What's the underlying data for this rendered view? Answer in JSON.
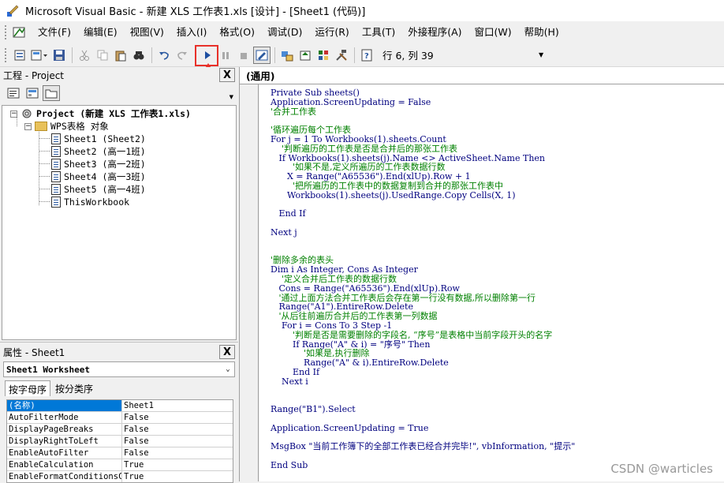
{
  "window": {
    "title": "Microsoft Visual Basic - 新建 XLS 工作表1.xls [设计] - [Sheet1 (代码)]"
  },
  "menu": {
    "items": [
      "文件(F)",
      "编辑(E)",
      "视图(V)",
      "插入(I)",
      "格式(O)",
      "调试(D)",
      "运行(R)",
      "工具(T)",
      "外接程序(A)",
      "窗口(W)",
      "帮助(H)"
    ]
  },
  "toolbar": {
    "status": "行 6, 列 39"
  },
  "project_panel": {
    "title": "工程 - Project",
    "close": "X",
    "tree": {
      "root": "Project (新建 XLS 工作表1.xls)",
      "folder": "WPS表格 对象",
      "items": [
        "Sheet1 (Sheet2)",
        "Sheet2 (高一1班)",
        "Sheet3 (高一2班)",
        "Sheet4 (高一3班)",
        "Sheet5 (高一4班)",
        "ThisWorkbook"
      ]
    }
  },
  "properties_panel": {
    "title": "属性 - Sheet1",
    "close": "X",
    "object": "Sheet1 Worksheet",
    "tabs": [
      "按字母序",
      "按分类序"
    ],
    "rows": [
      {
        "name": "(名称)",
        "value": "Sheet1"
      },
      {
        "name": "AutoFilterMode",
        "value": "False"
      },
      {
        "name": "DisplayPageBreaks",
        "value": "False"
      },
      {
        "name": "DisplayRightToLeft",
        "value": "False"
      },
      {
        "name": "EnableAutoFilter",
        "value": "False"
      },
      {
        "name": "EnableCalculation",
        "value": "True"
      },
      {
        "name": "EnableFormatConditionsCa",
        "value": "True"
      }
    ]
  },
  "code_window": {
    "scope": "(通用)",
    "lines": [
      {
        "text": "Private Sub sheets()",
        "kind": "code"
      },
      {
        "text": "Application.ScreenUpdating = False",
        "kind": "code"
      },
      {
        "text": "'合并工作表",
        "kind": "comment"
      },
      {
        "text": "",
        "kind": "code"
      },
      {
        "text": "'循环遍历每个工作表",
        "kind": "comment"
      },
      {
        "text": "For j = 1 To Workbooks(1).sheets.Count",
        "kind": "code"
      },
      {
        "text": "    '判断遍历的工作表是否是合并后的那张工作表",
        "kind": "comment"
      },
      {
        "text": "   If Workbooks(1).sheets(j).Name <> ActiveSheet.Name Then",
        "kind": "code"
      },
      {
        "text": "        '如果不是,定义所遍历的工作表数据行数",
        "kind": "comment"
      },
      {
        "text": "      X = Range(\"A65536\").End(xlUp).Row + 1",
        "kind": "code"
      },
      {
        "text": "        '把所遍历的工作表中的数据复制到合并的那张工作表中",
        "kind": "comment"
      },
      {
        "text": "      Workbooks(1).sheets(j).UsedRange.Copy Cells(X, 1)",
        "kind": "code"
      },
      {
        "text": "",
        "kind": "code"
      },
      {
        "text": "   End If",
        "kind": "code"
      },
      {
        "text": "",
        "kind": "code"
      },
      {
        "text": "Next j",
        "kind": "code"
      },
      {
        "text": "",
        "kind": "code"
      },
      {
        "text": "",
        "kind": "code"
      },
      {
        "text": "'删除多余的表头",
        "kind": "comment"
      },
      {
        "text": "Dim i As Integer, Cons As Integer",
        "kind": "code"
      },
      {
        "text": "    '定义合并后工作表的数据行数",
        "kind": "comment"
      },
      {
        "text": "   Cons = Range(\"A65536\").End(xlUp).Row",
        "kind": "code"
      },
      {
        "text": "   '通过上面方法合并工作表后会存在第一行没有数据,所以删除第一行",
        "kind": "comment"
      },
      {
        "text": "   Range(\"A1\").EntireRow.Delete",
        "kind": "code"
      },
      {
        "text": "   '从后往前遍历合并后的工作表第一列数据",
        "kind": "comment"
      },
      {
        "text": "    For i = Cons To 3 Step -1",
        "kind": "code"
      },
      {
        "text": "        '判断是否是需要删除的字段名, “序号”是表格中当前字段开头的名字",
        "kind": "comment"
      },
      {
        "text": "        If Range(\"A\" & i) = \"序号\" Then",
        "kind": "code"
      },
      {
        "text": "            '如果是,执行删除",
        "kind": "comment"
      },
      {
        "text": "            Range(\"A\" & i).EntireRow.Delete",
        "kind": "code"
      },
      {
        "text": "        End If",
        "kind": "code"
      },
      {
        "text": "    Next i",
        "kind": "code"
      },
      {
        "text": "",
        "kind": "code"
      },
      {
        "text": "",
        "kind": "code"
      },
      {
        "text": "Range(\"B1\").Select",
        "kind": "code"
      },
      {
        "text": "",
        "kind": "code"
      },
      {
        "text": "Application.ScreenUpdating = True",
        "kind": "code"
      },
      {
        "text": "",
        "kind": "code"
      },
      {
        "text": "MsgBox \"当前工作簿下的全部工作表已经合并完毕!\", vbInformation, \"提示\"",
        "kind": "code"
      },
      {
        "text": "",
        "kind": "code"
      },
      {
        "text": "End Sub",
        "kind": "code"
      }
    ]
  },
  "watermark": "CSDN @warticles",
  "colors": {
    "highlight": "#e8312a",
    "comment": "#008000",
    "keyword": "#00007f",
    "selection": "#0078d7"
  }
}
